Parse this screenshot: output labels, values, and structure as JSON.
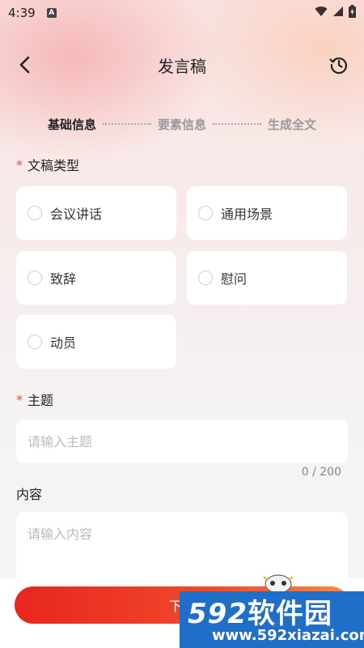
{
  "status_bar": {
    "time": "4:39",
    "badge": "A"
  },
  "header": {
    "title": "发言稿"
  },
  "steps": [
    {
      "label": "基础信息",
      "active": true
    },
    {
      "label": "要素信息",
      "active": false
    },
    {
      "label": "生成全文",
      "active": false
    }
  ],
  "doc_type": {
    "required_mark": "*",
    "label": "文稿类型",
    "options": [
      "会议讲话",
      "通用场景",
      "致辞",
      "慰问",
      "动员"
    ]
  },
  "topic": {
    "required_mark": "*",
    "label": "主题",
    "placeholder": "请输入主题",
    "counter": "0 / 200"
  },
  "content": {
    "label": "内容",
    "placeholder": "请输入内容"
  },
  "next_button": {
    "label": "下一"
  },
  "watermark": {
    "logo_num": "592",
    "logo_text": "软件园",
    "url": "www.592xiazai.com"
  },
  "colors": {
    "accent": "#e8261e",
    "required": "#e84a3a",
    "watermark_bg": "#1f6fc9"
  }
}
